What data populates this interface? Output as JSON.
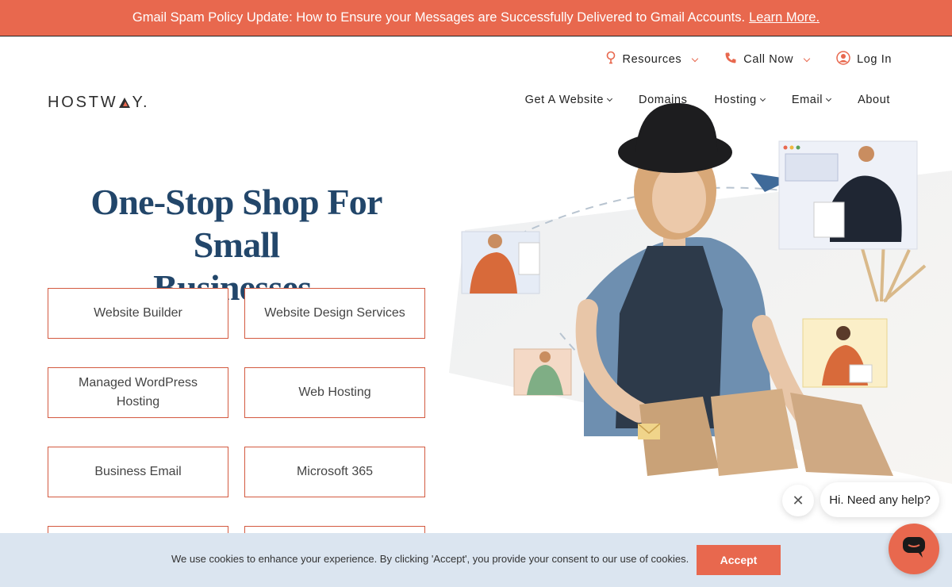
{
  "announcement": {
    "text": "Gmail Spam Policy Update: How to Ensure your Messages are Successfully Delivered to Gmail Accounts.",
    "link": "Learn More."
  },
  "utility_nav": {
    "resources": "Resources",
    "call_now": "Call Now",
    "log_in": "Log In"
  },
  "logo": {
    "part1": "HOSTW",
    "part2": "Y."
  },
  "main_nav": {
    "get_website": "Get A Website",
    "domains": "Domains",
    "hosting": "Hosting",
    "email": "Email",
    "about": "About"
  },
  "hero": {
    "title_line1": "One-Stop Shop For Small",
    "title_line2": "Businesses."
  },
  "services": {
    "website_builder": "Website Builder",
    "design_services": "Website Design Services",
    "managed_wp": "Managed WordPress Hosting",
    "web_hosting": "Web Hosting",
    "business_email": "Business Email",
    "microsoft_365": "Microsoft 365"
  },
  "cookie": {
    "text": "We use cookies to enhance your experience. By clicking 'Accept', you provide your consent to our use of cookies.",
    "accept": "Accept"
  },
  "chat": {
    "bubble": "Hi. Need any help?"
  },
  "colors": {
    "brand_coral": "#e8684e",
    "heading_navy": "#22466a",
    "cookie_bg": "#dbe5f0"
  }
}
